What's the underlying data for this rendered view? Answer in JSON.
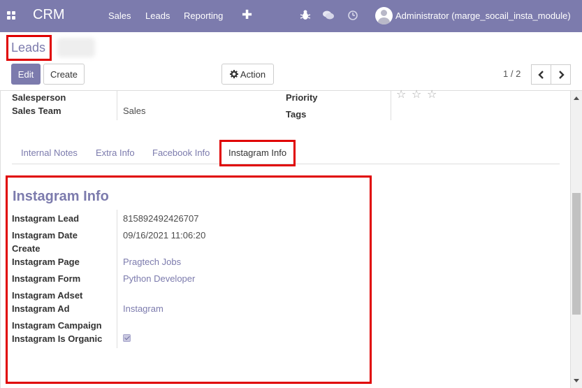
{
  "navbar": {
    "brand": "CRM",
    "menu": [
      "Sales",
      "Leads",
      "Reporting"
    ],
    "quick_create_icon": "plus-icon",
    "system_icons": [
      "bug-icon",
      "chat-icon",
      "clock-icon"
    ],
    "user": "Administrator (marge_socail_insta_module)",
    "bg_color": "#7c7bad"
  },
  "control_panel": {
    "breadcrumb": "Leads",
    "edit_label": "Edit",
    "create_label": "Create",
    "action_label": "Action",
    "pager": "1 / 2"
  },
  "form": {
    "salesperson_label": "Salesperson",
    "sales_team_label": "Sales Team",
    "sales_team_value": "Sales",
    "priority_label": "Priority",
    "tags_label": "Tags",
    "priority_stars": "☆"
  },
  "tabs": [
    "Internal Notes",
    "Extra Info",
    "Facebook Info",
    "Instagram Info"
  ],
  "instagram": {
    "title": "Instagram Info",
    "fields": [
      {
        "label": "Instagram Lead",
        "value": "815892492426707"
      },
      {
        "label": "Instagram Date",
        "value": "09/16/2021 11:06:20"
      },
      {
        "label": "Create",
        "value": ""
      },
      {
        "label": "Instagram Page",
        "value": "Pragtech Jobs"
      },
      {
        "label": "Instagram Form",
        "value": "Python Developer"
      },
      {
        "label": "Instagram Adset",
        "value": ""
      },
      {
        "label": "Instagram Ad",
        "value": "Instagram"
      },
      {
        "label": "Instagram Campaign",
        "value": ""
      },
      {
        "label": "Instagram Is Organic",
        "value": ""
      }
    ],
    "is_organic": true
  },
  "highlight_color": "#e00000"
}
